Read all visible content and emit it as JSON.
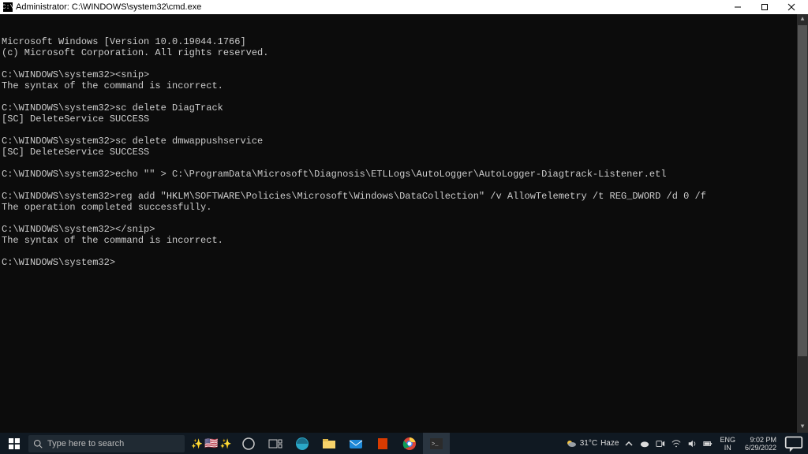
{
  "window": {
    "icon_glyph": "C:\\",
    "title": "Administrator: C:\\WINDOWS\\system32\\cmd.exe",
    "minimize": "—",
    "maximize": "▢",
    "close": "✕"
  },
  "console_lines": [
    "Microsoft Windows [Version 10.0.19044.1766]",
    "(c) Microsoft Corporation. All rights reserved.",
    "",
    "C:\\WINDOWS\\system32><snip>",
    "The syntax of the command is incorrect.",
    "",
    "C:\\WINDOWS\\system32>sc delete DiagTrack",
    "[SC] DeleteService SUCCESS",
    "",
    "C:\\WINDOWS\\system32>sc delete dmwappushservice",
    "[SC] DeleteService SUCCESS",
    "",
    "C:\\WINDOWS\\system32>echo \"\" > C:\\ProgramData\\Microsoft\\Diagnosis\\ETLLogs\\AutoLogger\\AutoLogger-Diagtrack-Listener.etl",
    "",
    "C:\\WINDOWS\\system32>reg add \"HKLM\\SOFTWARE\\Policies\\Microsoft\\Windows\\DataCollection\" /v AllowTelemetry /t REG_DWORD /d 0 /f",
    "The operation completed successfully.",
    "",
    "C:\\WINDOWS\\system32></snip>",
    "The syntax of the command is incorrect.",
    "",
    "C:\\WINDOWS\\system32>"
  ],
  "taskbar": {
    "search_placeholder": "Type here to search",
    "weather_temp": "31°C",
    "weather_cond": "Haze",
    "lang_top": "ENG",
    "lang_bot": "IN",
    "time": "9:02 PM",
    "date": "6/29/2022"
  }
}
